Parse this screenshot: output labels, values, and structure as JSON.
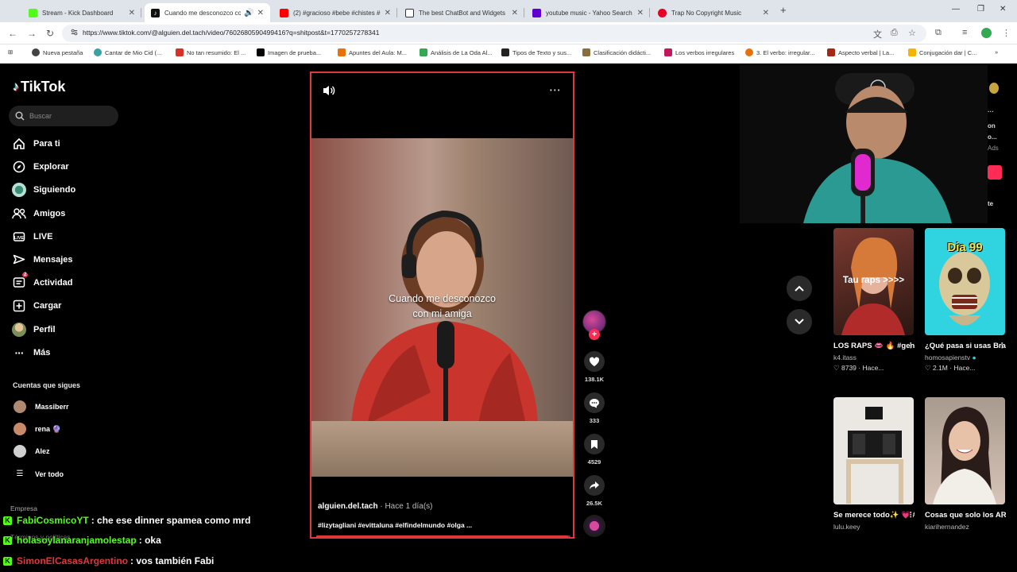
{
  "browser": {
    "tabs": [
      {
        "title": "Stream - Kick Dashboard",
        "favicon_color": "#53fc18",
        "active": false
      },
      {
        "title": "Cuando me desconozco co",
        "favicon_color": "#111111",
        "active": true
      },
      {
        "title": "(2) #gracioso #bebe #chistes #",
        "favicon_color": "#ff0000",
        "active": false
      },
      {
        "title": "The best ChatBot and Widgets",
        "favicon_color": "#333333",
        "active": false
      },
      {
        "title": "youtube music - Yahoo Search",
        "favicon_color": "#6001d2",
        "active": false
      },
      {
        "title": "Trap No Copyright Music",
        "favicon_color": "#e60023",
        "active": false
      }
    ],
    "url": "https://www.tiktok.com/@alguien.del.tach/video/7602680590499416?q=shitpost&t=1770257278341",
    "bookmarks": [
      {
        "label": "Nueva pestaña",
        "color": "#444444"
      },
      {
        "label": "Cantar de Mio Cid (...",
        "color": "#3aa0a0"
      },
      {
        "label": "No tan resumido: El ...",
        "color": "#d93025"
      },
      {
        "label": "Imagen de prueba...",
        "color": "#000000"
      },
      {
        "label": "Apuntes del Aula: M...",
        "color": "#e8710a"
      },
      {
        "label": "Análisis de La Oda Al...",
        "color": "#34a853"
      },
      {
        "label": "Tipos de Texto y sus...",
        "color": "#222222"
      },
      {
        "label": "Clasificación didácti...",
        "color": "#8a6d3b"
      },
      {
        "label": "Los verbos irregulares",
        "color": "#c2185b"
      },
      {
        "label": "3. El verbo: irregular...",
        "color": "#e8710a"
      },
      {
        "label": "Aspecto verbal | La...",
        "color": "#a52714"
      },
      {
        "label": "Conjugación dar | C...",
        "color": "#f4b400"
      }
    ]
  },
  "tiktok": {
    "brand": "TikTok",
    "search_placeholder": "Buscar",
    "nav": [
      {
        "label": "Para ti",
        "icon": "home-icon"
      },
      {
        "label": "Explorar",
        "icon": "compass-icon"
      },
      {
        "label": "Siguiendo",
        "icon": "following-avatar-icon"
      },
      {
        "label": "Amigos",
        "icon": "friends-icon"
      },
      {
        "label": "LIVE",
        "icon": "live-icon"
      },
      {
        "label": "Mensajes",
        "icon": "messages-icon"
      },
      {
        "label": "Actividad",
        "icon": "activity-icon",
        "badge": "2"
      },
      {
        "label": "Cargar",
        "icon": "upload-icon"
      },
      {
        "label": "Perfil",
        "icon": "profile-avatar-icon"
      },
      {
        "label": "Más",
        "icon": "more-icon"
      }
    ],
    "following_title": "Cuentas que sigues",
    "following": [
      {
        "name": "Massiberr",
        "color": "#b08a70"
      },
      {
        "name": "rena 🔮",
        "color": "#c98a6a"
      },
      {
        "name": "Alez",
        "color": "#d0d0d0"
      }
    ],
    "see_all": "Ver todo",
    "footer_company": "Empresa",
    "footer_terms": "Términos y políticas"
  },
  "video": {
    "caption_line1": "Cuando me desconozco",
    "caption_line2": "con mi amiga",
    "author": "alguien.del.tach",
    "time": " · Hace 1 día(s)",
    "hashtags": "#lizytagliani #evittaluna #elfindelmundo #olga ...",
    "progress": 0.99,
    "likes": "138.1K",
    "comments": "333",
    "saves": "4529",
    "shares": "26.5K"
  },
  "sidebar_right_cut": {
    "line1": "on",
    "line2": "o...",
    "line3": "Ads",
    "line4": "te"
  },
  "recommendations": [
    {
      "thumb_text": "Tau raps >>>>",
      "title": "LOS RAPS 👄 🔥 #genuineinteract...",
      "user": "k4.itass",
      "likes": "8739",
      "when": "Hace...",
      "bg": "#5a2a2a"
    },
    {
      "thumb_text": "Dia 99",
      "title": "¿Qué pasa si usas Brackets durante...",
      "user": "homosapienstv",
      "likes": "2.1M",
      "when": "Hace...",
      "bg": "#2fd4e0"
    },
    {
      "thumb_text": "",
      "title": "Se merece todo✨ 💗 #casa #mam...",
      "user": "lulu.keey",
      "likes": "",
      "when": "",
      "bg": "#e9e7e4"
    },
    {
      "thumb_text": "",
      "title": "Cosas que solo los ARGENTINOS...",
      "user": "kiarihernandez",
      "likes": "",
      "when": "",
      "bg": "#c7b3a8"
    }
  ],
  "chat": [
    {
      "user": "FabiCosmicoYT",
      "user_color": "#53fc18",
      "message": ": che ese dinner spamea como mrd"
    },
    {
      "user": "holasoylanaranjamolestap",
      "user_color": "#53fc18",
      "message": ": oka"
    },
    {
      "user": "SimonElCasasArgentino",
      "user_color": "#e0373d",
      "message": ": vos también Fabi"
    }
  ]
}
